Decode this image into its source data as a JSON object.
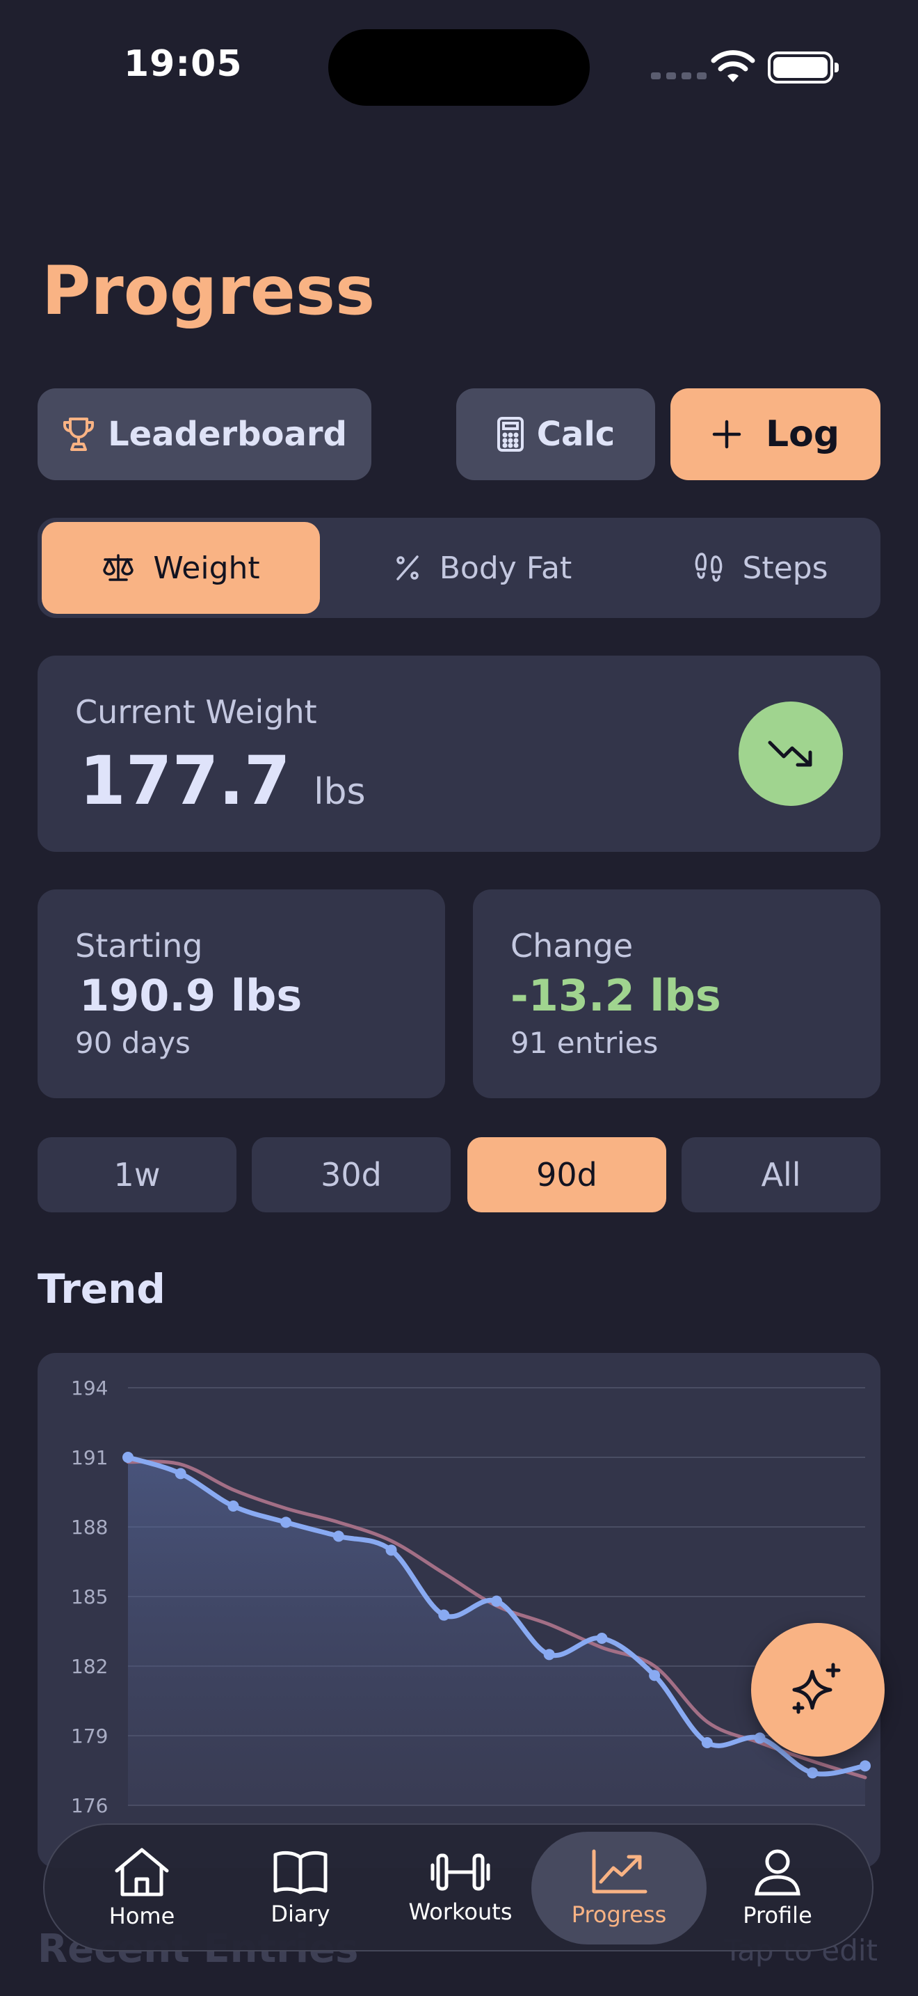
{
  "status": {
    "time": "19:05"
  },
  "header": {
    "title": "Progress"
  },
  "actions": {
    "leaderboard": "Leaderboard",
    "calc": "Calc",
    "log": "Log"
  },
  "metrics_tabs": [
    {
      "label": "Weight",
      "icon": "scale-icon",
      "active": true
    },
    {
      "label": "Body Fat",
      "icon": "percent-icon",
      "active": false
    },
    {
      "label": "Steps",
      "icon": "footprints-icon",
      "active": false
    }
  ],
  "current": {
    "label": "Current Weight",
    "value": "177.7",
    "unit": "lbs",
    "trend_icon": "trending-down-icon"
  },
  "starting": {
    "label": "Starting",
    "value": "190.9 lbs",
    "sub": "90 days"
  },
  "change": {
    "label": "Change",
    "value": "-13.2 lbs",
    "sub": "91 entries",
    "color": "#a0d48f"
  },
  "ranges": [
    {
      "label": "1w",
      "active": false
    },
    {
      "label": "30d",
      "active": false
    },
    {
      "label": "90d",
      "active": true
    },
    {
      "label": "All",
      "active": false
    }
  ],
  "trend": {
    "title": "Trend"
  },
  "chart_data": {
    "type": "line",
    "ylim": [
      176,
      194
    ],
    "yticks": [
      "194",
      "191",
      "188",
      "185",
      "182",
      "179",
      "176"
    ],
    "grid": true,
    "series": [
      {
        "x": [
          0,
          1,
          2,
          3,
          4,
          5,
          6,
          7,
          8,
          9,
          10,
          11,
          12,
          13,
          14
        ],
        "values": [
          191.0,
          190.3,
          188.9,
          188.2,
          187.6,
          187.0,
          184.2,
          184.8,
          182.5,
          183.2,
          181.6,
          178.7,
          178.9,
          177.4,
          177.7
        ],
        "color": "#89aaf2",
        "markers": true
      },
      {
        "x": [
          0,
          1,
          2,
          3,
          4,
          5,
          6,
          7,
          8,
          9,
          10,
          11,
          12,
          13,
          14
        ],
        "values": [
          190.8,
          190.7,
          189.6,
          188.8,
          188.2,
          187.4,
          186.0,
          184.6,
          183.8,
          182.8,
          182.0,
          179.6,
          178.7,
          177.9,
          177.2
        ],
        "color": "#a36f86",
        "markers": false
      }
    ]
  },
  "recent": {
    "title": "Recent Entries",
    "hint": "Tap to edit"
  },
  "tabbar": [
    {
      "label": "Home",
      "icon": "home-icon",
      "active": false
    },
    {
      "label": "Diary",
      "icon": "book-icon",
      "active": false
    },
    {
      "label": "Workouts",
      "icon": "dumbbell-icon",
      "active": false
    },
    {
      "label": "Progress",
      "icon": "chart-icon",
      "active": true
    },
    {
      "label": "Profile",
      "icon": "user-icon",
      "active": false
    }
  ],
  "colors": {
    "accent": "#f9b384",
    "background": "#1f1f2e",
    "card": "#33354a",
    "positive": "#a0d48f"
  }
}
